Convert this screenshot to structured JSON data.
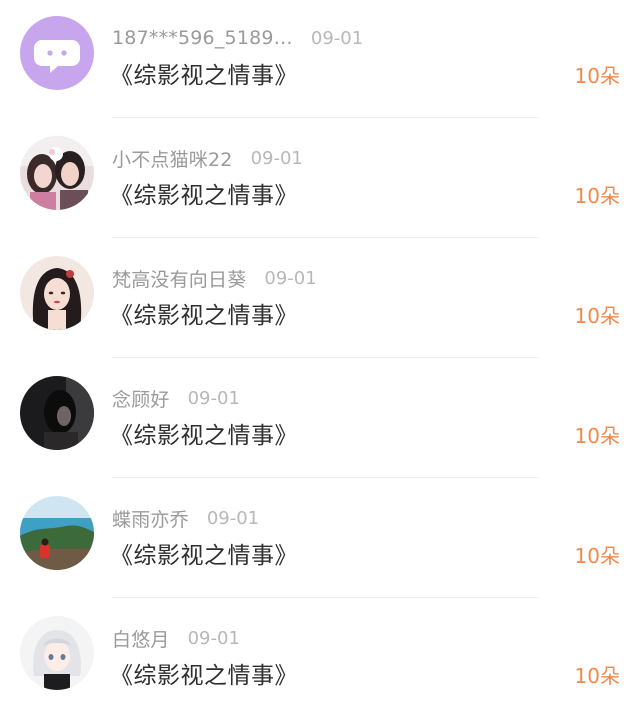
{
  "gift_list": {
    "rows": [
      {
        "username": "187***596_5189…",
        "date": "09-01",
        "title": "《综影视之情事》",
        "amount": "10朵",
        "avatar": "chat-bubble-default-avatar"
      },
      {
        "username": "小不点猫咪22",
        "date": "09-01",
        "title": "《综影视之情事》",
        "amount": "10朵",
        "avatar": "couple-photo-avatar"
      },
      {
        "username": "梵高没有向日葵",
        "date": "09-01",
        "title": "《综影视之情事》",
        "amount": "10朵",
        "avatar": "illustrated-girl-avatar"
      },
      {
        "username": "念顾好",
        "date": "09-01",
        "title": "《综影视之情事》",
        "amount": "10朵",
        "avatar": "dark-portrait-avatar"
      },
      {
        "username": "蝶雨亦乔",
        "date": "09-01",
        "title": "《综影视之情事》",
        "amount": "10朵",
        "avatar": "seaside-landscape-avatar"
      },
      {
        "username": "白悠月",
        "date": "09-01",
        "title": "《综影视之情事》",
        "amount": "10朵",
        "avatar": "anime-white-hair-avatar"
      }
    ]
  },
  "colors": {
    "amount": "#f3884a",
    "username": "#9a9a9a",
    "title": "#2e2e2e",
    "default_avatar_bg": "#c7a6ee"
  }
}
